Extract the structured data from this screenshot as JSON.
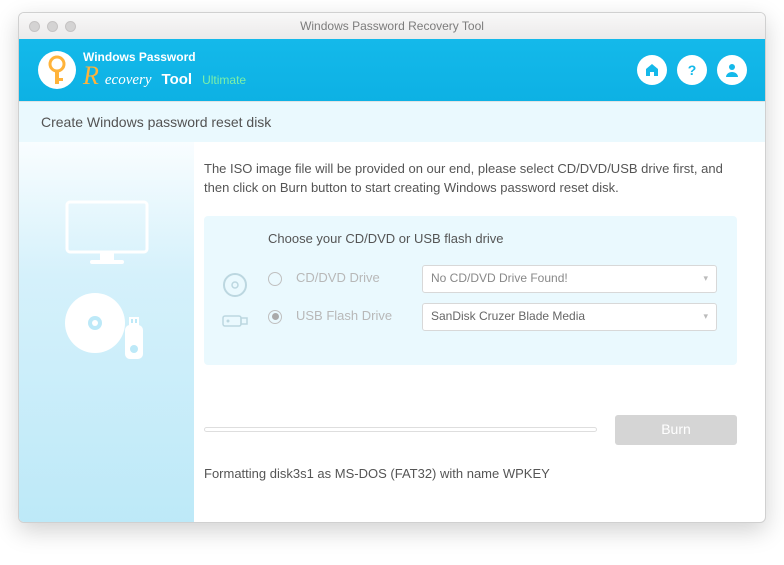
{
  "window": {
    "title": "Windows Password Recovery Tool"
  },
  "header": {
    "logo_top": "Windows Password",
    "logo_recovery": "ecovery",
    "logo_tool": "Tool",
    "logo_edition": "Ultimate"
  },
  "subtitle": "Create Windows password reset disk",
  "main": {
    "description": "The ISO image file will be provided on our end, please select CD/DVD/USB drive first, and then click on Burn button to start creating Windows password reset disk.",
    "panel_title": "Choose your CD/DVD or USB flash drive",
    "cd_label": "CD/DVD Drive",
    "cd_value": "No CD/DVD Drive Found!",
    "usb_label": "USB Flash Drive",
    "usb_value": "SanDisk Cruzer Blade Media",
    "burn_label": "Burn",
    "status": "Formatting disk3s1 as MS-DOS (FAT32) with name WPKEY"
  }
}
